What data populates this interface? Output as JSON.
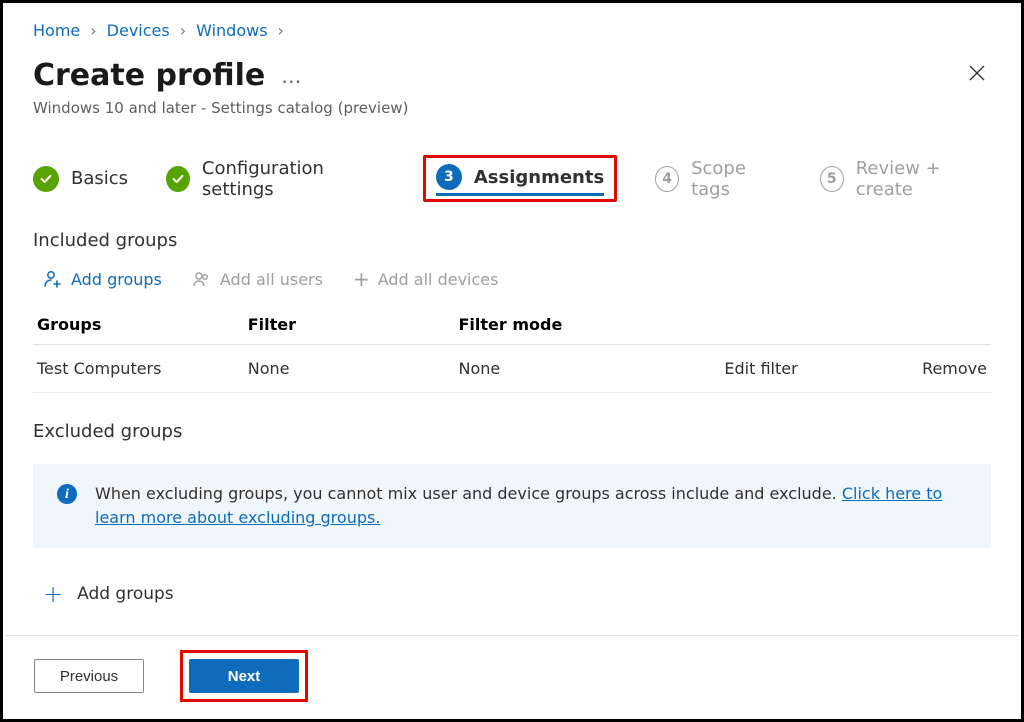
{
  "breadcrumb": {
    "home": "Home",
    "devices": "Devices",
    "windows": "Windows"
  },
  "header": {
    "title": "Create profile",
    "subtitle": "Windows 10 and later - Settings catalog (preview)"
  },
  "wizard": {
    "step1": "Basics",
    "step2": "Configuration settings",
    "step3_num": "3",
    "step3": "Assignments",
    "step4_num": "4",
    "step4": "Scope tags",
    "step5_num": "5",
    "step5": "Review + create"
  },
  "included": {
    "heading": "Included groups",
    "add_groups": "Add groups",
    "add_all_users": "Add all users",
    "add_all_devices": "Add all devices",
    "columns": {
      "groups": "Groups",
      "filter": "Filter",
      "filter_mode": "Filter mode"
    },
    "rows": [
      {
        "group": "Test Computers",
        "filter": "None",
        "filter_mode": "None",
        "edit": "Edit filter",
        "remove": "Remove"
      }
    ]
  },
  "excluded": {
    "heading": "Excluded groups",
    "info_text": "When excluding groups, you cannot mix user and device groups across include and exclude. ",
    "info_link": "Click here to learn more about excluding groups.",
    "add_groups": "Add groups"
  },
  "footer": {
    "previous": "Previous",
    "next": "Next"
  }
}
